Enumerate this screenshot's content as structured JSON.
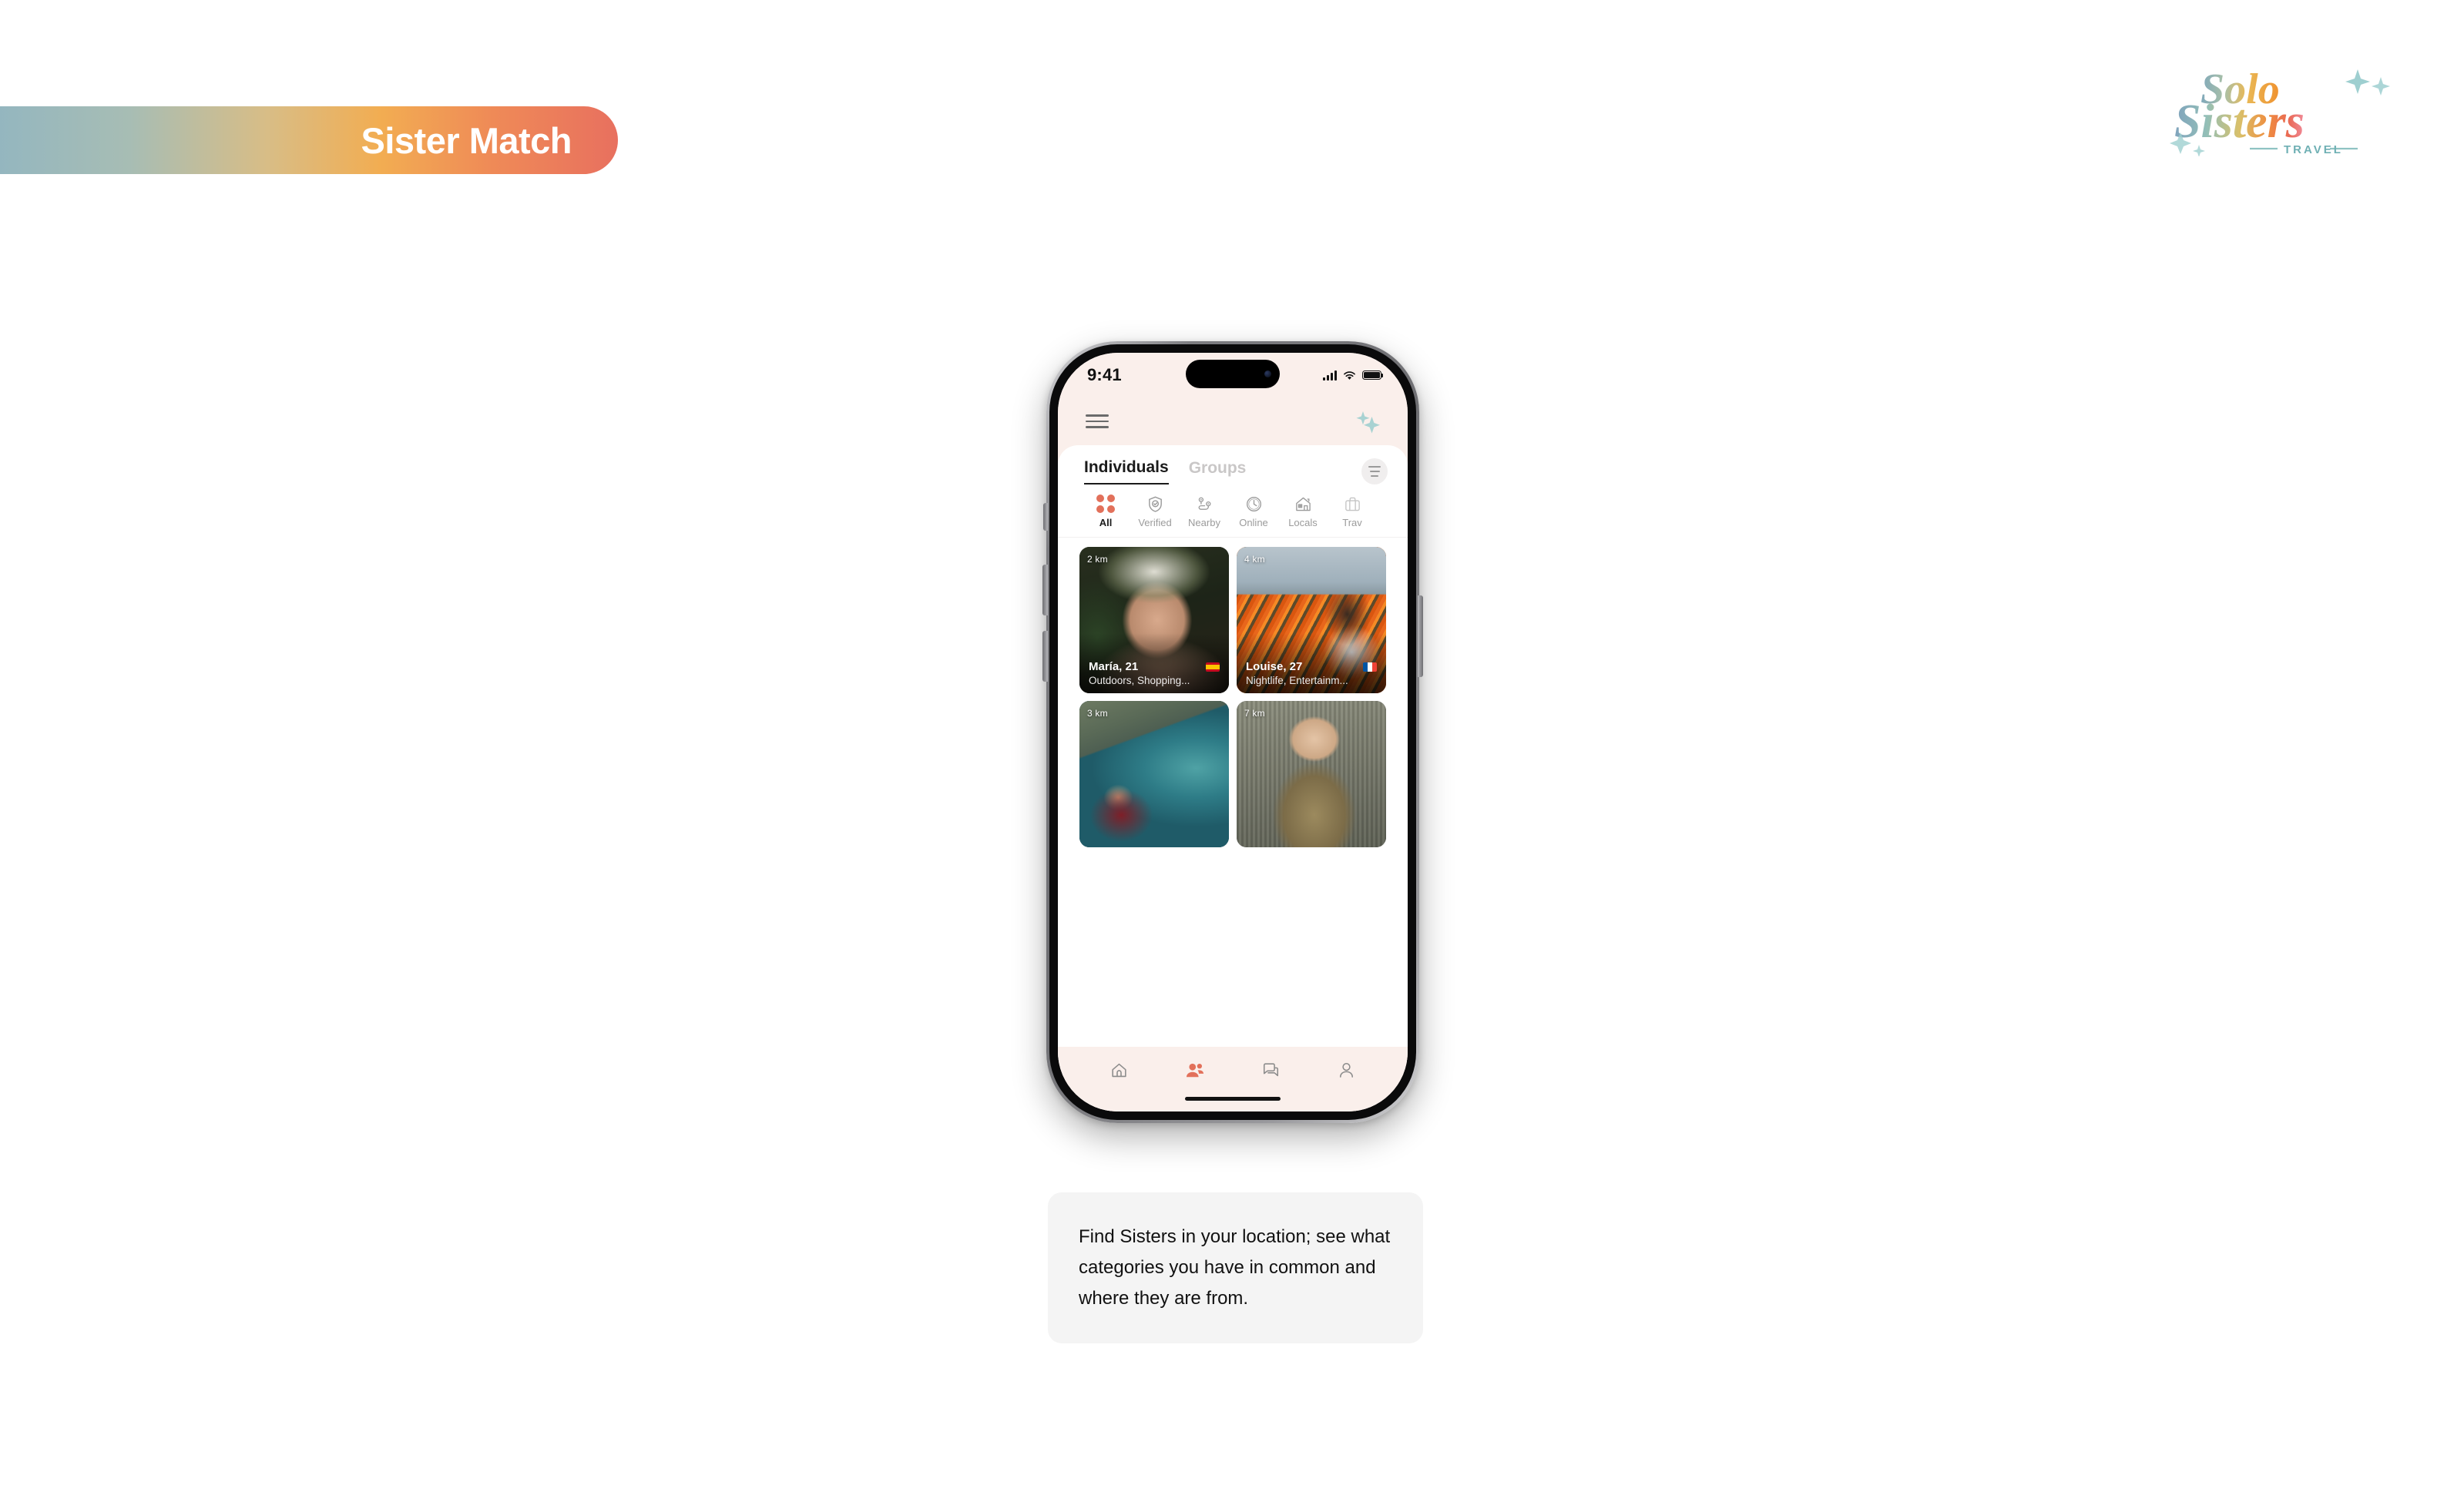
{
  "banner": {
    "title": "Sister Match"
  },
  "logo": {
    "line1": "Solo",
    "line2": "Sisters",
    "tagline": "TRAVEL"
  },
  "phone": {
    "statusbar": {
      "time": "9:41",
      "signal_icon": "cellular-signal-icon",
      "wifi_icon": "wifi-icon",
      "battery_icon": "battery-full-icon"
    },
    "header": {
      "menu_icon": "hamburger-menu-icon",
      "sparkle_icon": "sparkles-icon"
    },
    "tabs": [
      {
        "label": "Individuals",
        "active": true
      },
      {
        "label": "Groups",
        "active": false
      }
    ],
    "filter_button": {
      "icon": "filter-lines-icon"
    },
    "categories": [
      {
        "label": "All",
        "icon": "four-dots-icon",
        "active": true
      },
      {
        "label": "Verified",
        "icon": "shield-check-icon",
        "active": false
      },
      {
        "label": "Nearby",
        "icon": "route-pins-icon",
        "active": false
      },
      {
        "label": "Online",
        "icon": "clock-icon",
        "active": false
      },
      {
        "label": "Locals",
        "icon": "house-icon",
        "active": false
      },
      {
        "label": "Trav",
        "icon": "suitcase-icon",
        "active": false
      }
    ],
    "cards": [
      {
        "distance": "2 km",
        "name": "María, 21",
        "tags": "Outdoors, Shopping...",
        "flag": "flag-es",
        "photo": "ph-maria"
      },
      {
        "distance": "4 km",
        "name": "Louise, 27",
        "tags": "Nightlife, Entertainm...",
        "flag": "flag-fr",
        "photo": "ph-louise"
      },
      {
        "distance": "3 km",
        "name": "",
        "tags": "",
        "flag": "",
        "photo": "ph-cliff"
      },
      {
        "distance": "7 km",
        "name": "",
        "tags": "",
        "flag": "",
        "photo": "ph-sofia"
      }
    ],
    "bottom_nav": [
      {
        "icon": "home-icon",
        "active": false
      },
      {
        "icon": "people-icon",
        "active": true
      },
      {
        "icon": "chat-bubbles-icon",
        "active": false
      },
      {
        "icon": "person-profile-icon",
        "active": false
      }
    ]
  },
  "caption": {
    "text": "Find Sisters in your location; see what categories you have in common and where they are from."
  },
  "colors": {
    "accent_coral": "#e2705a",
    "phone_bg_pink": "#faefeb",
    "sparkle_teal": "#9ecfd0",
    "banner_gradient_start": "#93b6c0",
    "banner_gradient_end": "#e8705f",
    "caption_bg": "#f4f4f4"
  }
}
